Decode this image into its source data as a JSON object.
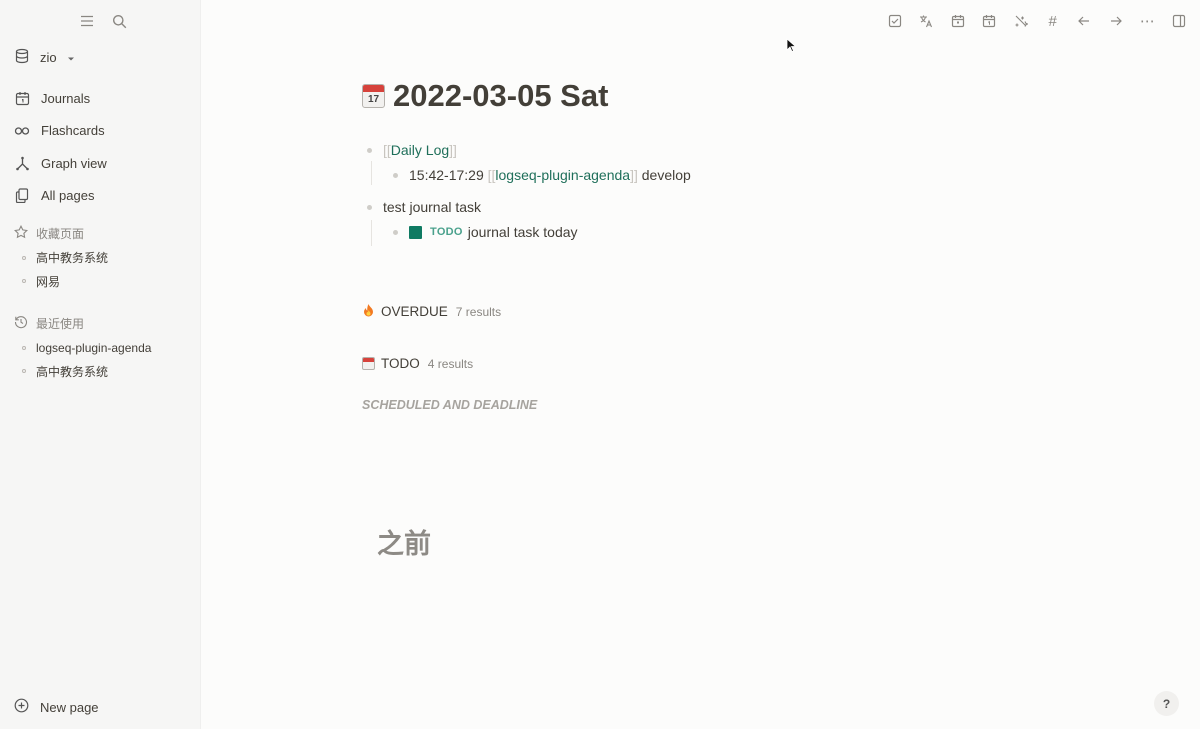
{
  "sidebar": {
    "graph_name": "zio",
    "nav": [
      {
        "label": "Journals",
        "icon": "calendar-icon"
      },
      {
        "label": "Flashcards",
        "icon": "infinity-icon"
      },
      {
        "label": "Graph view",
        "icon": "graph-icon"
      },
      {
        "label": "All pages",
        "icon": "pages-icon"
      }
    ],
    "favorites_title": "收藏页面",
    "favorites": [
      "高中教务系统",
      "网易"
    ],
    "recent_title": "最近使用",
    "recent": [
      "logseq-plugin-agenda",
      "高中教务系统"
    ],
    "new_page_label": "New page"
  },
  "toolbar": {
    "icons": [
      "checkbox-icon",
      "translate-icon",
      "calendar-icon",
      "calendar-day-icon",
      "sparkle-icon",
      "hashtag-icon",
      "arrow-left-icon",
      "arrow-right-icon",
      "more-icon",
      "sidebar-toggle-icon"
    ],
    "hashtag": "#",
    "more": "⋯"
  },
  "page": {
    "title": "2022-03-05 Sat",
    "emoji_day": "17",
    "blocks": {
      "daily_log_ref": "Daily Log",
      "time_range": "15:42-17:29",
      "plugin_ref": "logseq-plugin-agenda",
      "develop": "develop",
      "test_task": "test journal task",
      "todo_marker": "TODO",
      "todo_text": "journal task today"
    },
    "brackets": {
      "open": "[[",
      "close": "]]"
    },
    "overdue": {
      "label": "OVERDUE",
      "count": "7 results"
    },
    "todo_query": {
      "label": "TODO",
      "count": "4 results"
    },
    "scheduled": "SCHEDULED AND DEADLINE",
    "before": "之前"
  },
  "help_label": "?"
}
